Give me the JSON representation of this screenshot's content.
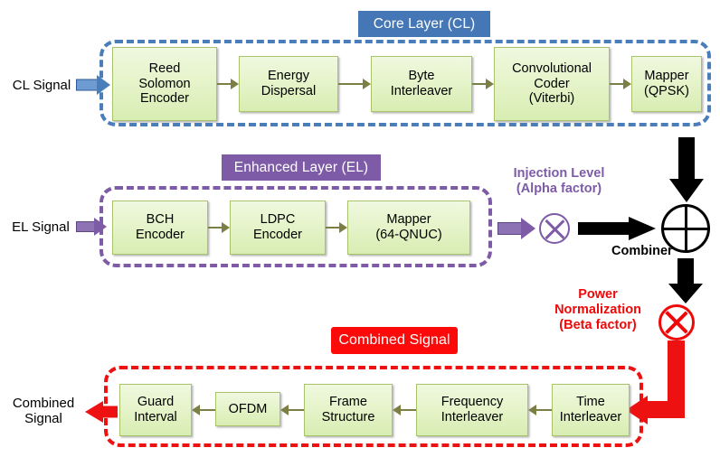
{
  "diagram": {
    "title": "Layered Division Multiplexing transmitter block diagram",
    "colors": {
      "core_layer": "#4576b5",
      "enhanced_layer": "#7d5ba6",
      "combined_signal": "#fc0a0a",
      "block_fill": "#e6f4cb",
      "block_border": "#a8c36a",
      "connector": "#7b7f43"
    },
    "layers": {
      "core": {
        "chip_label": "Core Layer (CL)",
        "input_label": "CL Signal",
        "blocks": [
          {
            "lines": [
              "Reed",
              "Solomon",
              "Encoder"
            ]
          },
          {
            "lines": [
              "Energy",
              "Dispersal"
            ]
          },
          {
            "lines": [
              "Byte",
              "Interleaver"
            ]
          },
          {
            "lines": [
              "Convolutional",
              "Coder",
              "(Viterbi)"
            ]
          },
          {
            "lines": [
              "Mapper",
              "(QPSK)"
            ]
          }
        ]
      },
      "enhanced": {
        "chip_label": "Enhanced Layer (EL)",
        "input_label": "EL Signal",
        "blocks": [
          {
            "lines": [
              "BCH",
              "Encoder"
            ]
          },
          {
            "lines": [
              "LDPC",
              "Encoder"
            ]
          },
          {
            "lines": [
              "Mapper",
              "(64-QNUC)"
            ]
          }
        ]
      },
      "combined": {
        "chip_label": "Combined Signal",
        "output_label_lines": [
          "Combined",
          "Signal"
        ],
        "blocks": [
          {
            "lines": [
              "Guard",
              "Interval"
            ]
          },
          {
            "lines": [
              "OFDM"
            ]
          },
          {
            "lines": [
              "Frame",
              "Structure"
            ]
          },
          {
            "lines": [
              "Frequency",
              "Interleaver"
            ]
          },
          {
            "lines": [
              "Time",
              "Interleaver"
            ]
          }
        ]
      }
    },
    "operators": {
      "injection": {
        "lines": [
          "Injection Level",
          "(Alpha factor)"
        ],
        "symbol": "multiply-circle"
      },
      "combiner": {
        "label": "Combiner",
        "symbol": "plus-circle"
      },
      "power_normalization": {
        "lines": [
          "Power",
          "Normalization",
          "(Beta factor)"
        ],
        "symbol": "multiply-circle"
      }
    }
  }
}
